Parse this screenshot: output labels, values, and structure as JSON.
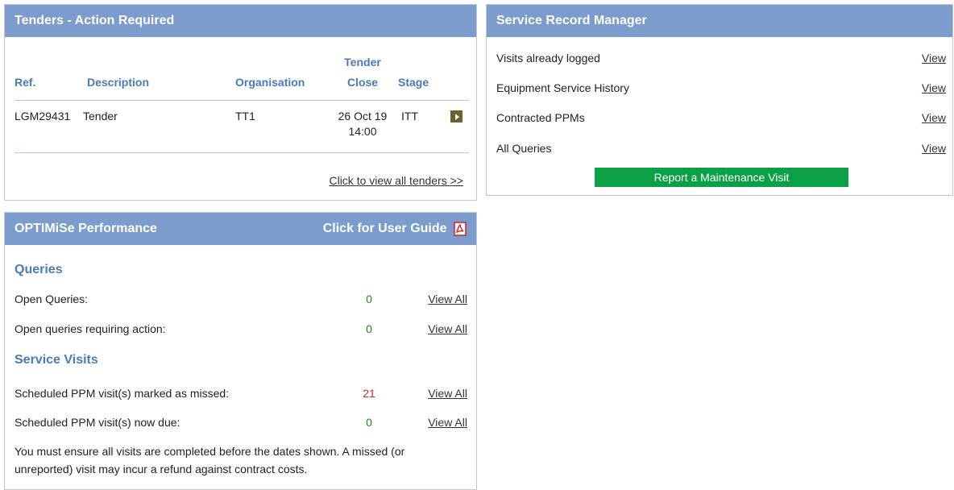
{
  "tenders": {
    "title": "Tenders - Action Required",
    "columns": {
      "ref": "Ref.",
      "description": "Description",
      "organisation": "Organisation",
      "tender_close_line1": "Tender",
      "tender_close_line2": "Close",
      "stage": "Stage"
    },
    "rows": [
      {
        "ref": "LGM29431",
        "description": "Tender",
        "organisation": "TT1",
        "close_date": "26 Oct 19",
        "close_time": "14:00",
        "stage": "ITT"
      }
    ],
    "view_all_label": "Click to view all tenders >>"
  },
  "service_record": {
    "title": "Service Record Manager",
    "items": [
      {
        "label": "Visits already logged",
        "link": "View"
      },
      {
        "label": "Equipment Service History",
        "link": "View"
      },
      {
        "label": "Contracted PPMs",
        "link": "View"
      },
      {
        "label": "All Queries",
        "link": "View"
      }
    ],
    "report_button": "Report a Maintenance Visit"
  },
  "performance": {
    "title": "OPTIMiSe Performance",
    "guide_link": "Click for User Guide",
    "queries_title": "Queries",
    "queries": [
      {
        "label": "Open Queries:",
        "value": "0",
        "link": "View All"
      },
      {
        "label": "Open queries requiring action:",
        "value": "0",
        "link": "View All"
      }
    ],
    "visits_title": "Service Visits",
    "visits": [
      {
        "label": "Scheduled PPM visit(s) marked as missed:",
        "value": "21",
        "link": "View All"
      },
      {
        "label": "Scheduled PPM visit(s) now due:",
        "value": "0",
        "link": "View All"
      }
    ],
    "note": "You must ensure all visits are completed before the dates shown. A missed (or unreported) visit may incur a refund against contract costs."
  },
  "colors": {
    "header_bg": "#7b9ccc",
    "accent_text": "#4a7ab8",
    "report_button": "#0aa146",
    "value_ok": "#1a8a1a",
    "value_alert": "#e02020"
  }
}
